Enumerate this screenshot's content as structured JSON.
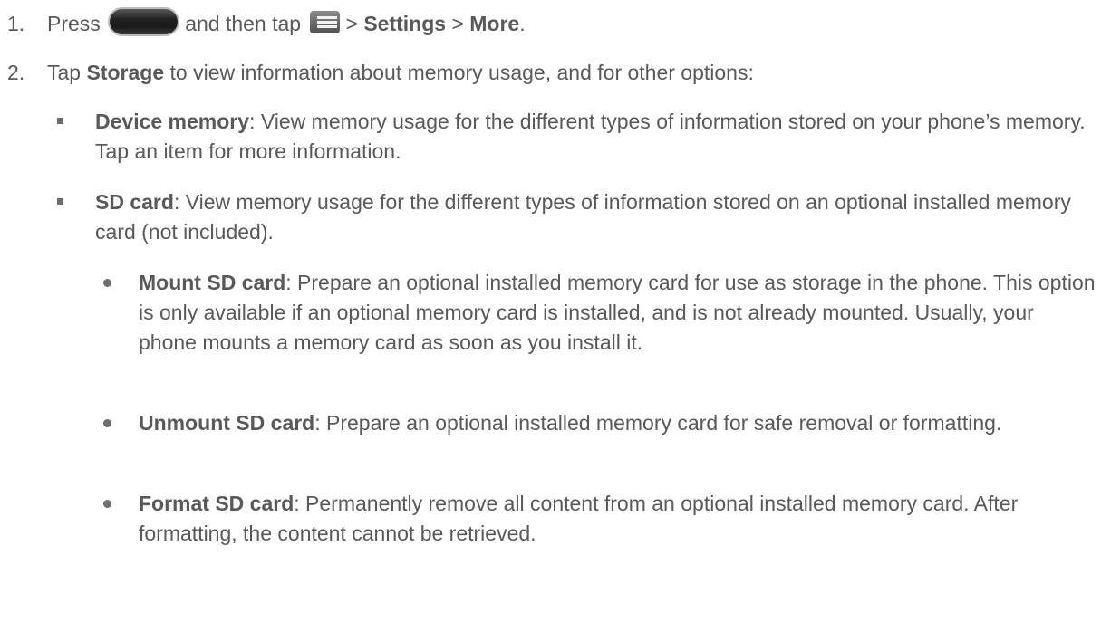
{
  "steps": [
    {
      "number": "1.",
      "text_press": "Press",
      "icon_home": "home-button-icon",
      "text_and_then_tap": "and then tap",
      "icon_menu": "menu-icon",
      "sep1": ">",
      "settings": "Settings",
      "sep2": ">",
      "more": "More",
      "end": "."
    },
    {
      "number": "2.",
      "text_tap": "Tap",
      "storage": "Storage",
      "rest": "to view information about memory usage, and for other options:"
    }
  ],
  "options": [
    {
      "term": "Device memory",
      "desc": ": View memory usage for the different types of information stored on your phone’s memory. Tap an item for more information."
    },
    {
      "term": "SD card",
      "desc": ": View memory usage for the different types of information stored on an optional installed memory card (not included).",
      "sub_options": [
        {
          "term": "Mount SD card",
          "desc": ": Prepare an optional installed memory card for use as storage in the phone. This option is only available if an optional memory card is installed, and is not already mounted. Usually, your phone mounts a memory card as soon as you install it."
        },
        {
          "term": "Unmount SD card",
          "desc": ": Prepare an optional installed memory card for safe removal or formatting."
        },
        {
          "term": "Format SD card",
          "desc": ": Permanently remove all content from an optional installed memory card. After formatting, the content cannot be retrieved."
        }
      ]
    }
  ],
  "colors": {
    "text": "#595959",
    "bullet": "#6e6e6e"
  }
}
